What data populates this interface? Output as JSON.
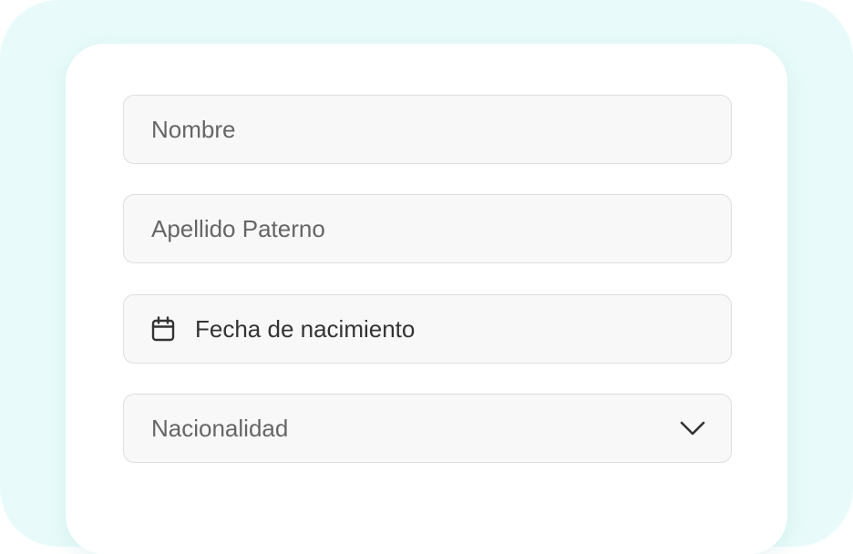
{
  "form": {
    "nombre": {
      "placeholder": "Nombre"
    },
    "apellido_paterno": {
      "placeholder": "Apellido Paterno"
    },
    "fecha_nacimiento": {
      "label": "Fecha de nacimiento",
      "icon": "calendar-icon"
    },
    "nacionalidad": {
      "placeholder": "Nacionalidad",
      "icon": "chevron-down-icon"
    }
  },
  "colors": {
    "background": "#e8fbfa",
    "card": "#ffffff",
    "field_bg": "#f8f8f8",
    "field_border": "#dedede",
    "placeholder_text": "#666666",
    "value_text": "#333333"
  }
}
